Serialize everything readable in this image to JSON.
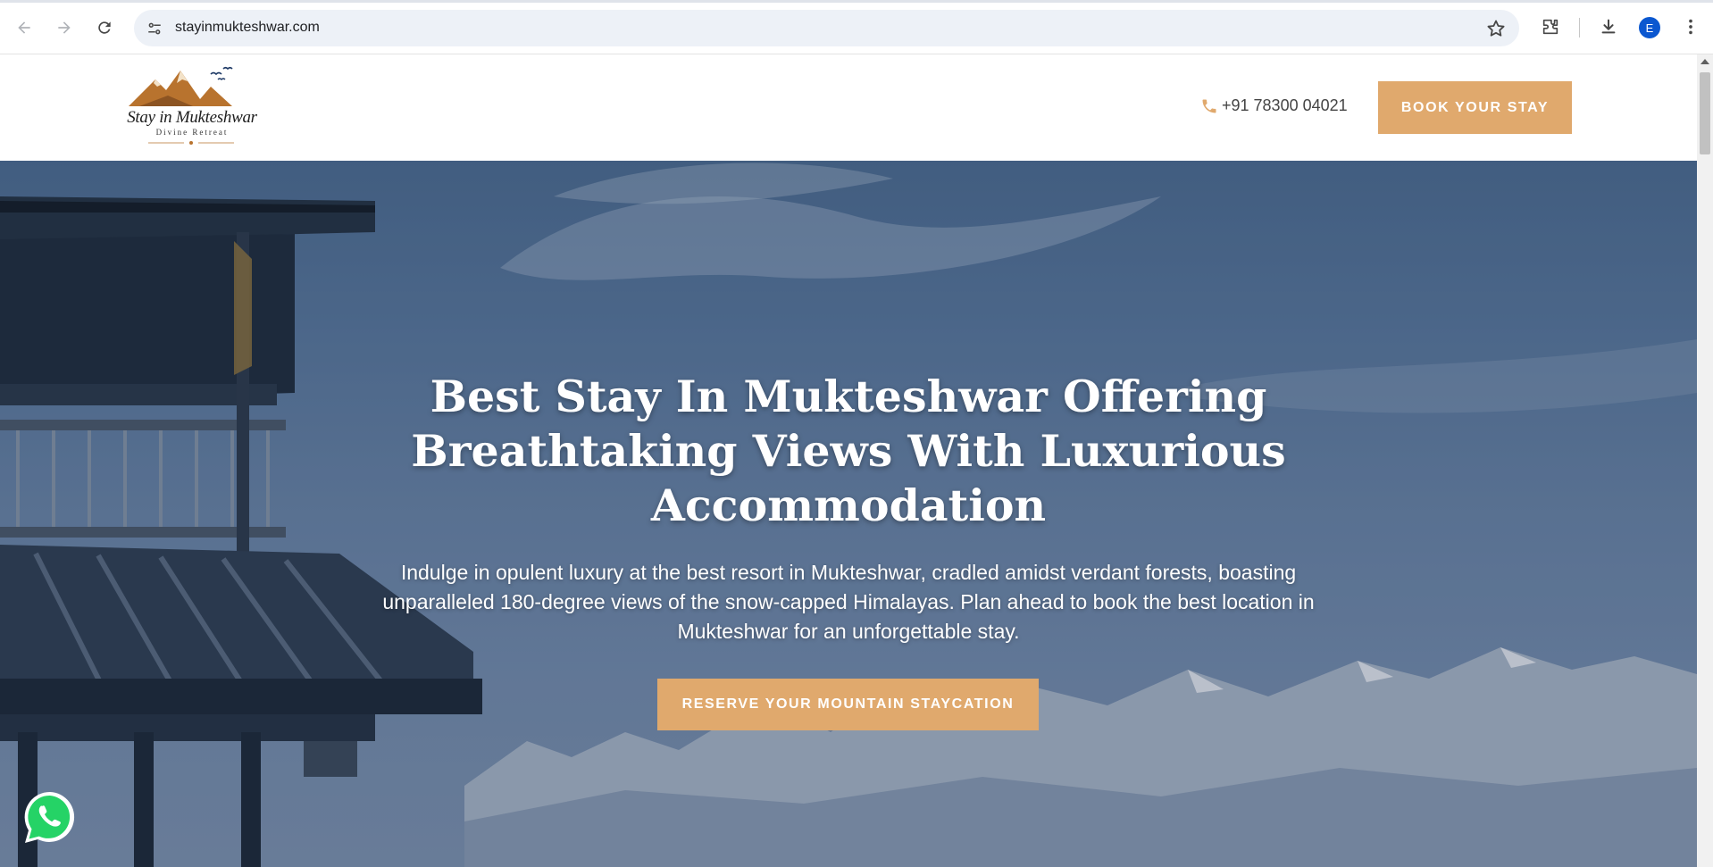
{
  "browser": {
    "url": "stayinmukteshwar.com",
    "profile_initial": "E",
    "icons": [
      "back-arrow-icon",
      "forward-arrow-icon",
      "reload-icon",
      "site-info-icon",
      "bookmark-star-icon",
      "extensions-icon",
      "download-icon",
      "menu-kebab-icon"
    ]
  },
  "header": {
    "logo_name": "Stay in Mukteshwar",
    "logo_tagline": "Divine Retreat",
    "phone": "+91 78300 04021",
    "book_label": "BOOK YOUR STAY"
  },
  "hero": {
    "title": "Best Stay In Mukteshwar Offering Breathtaking Views With Luxurious Accommodation",
    "subtitle": "Indulge in opulent luxury at the best resort in Mukteshwar, cradled amidst verdant forests, boasting unparalleled 180-degree views of the snow-capped Himalayas. Plan ahead to book the best location in Mukteshwar for an unforgettable stay.",
    "cta_label": "RESERVE YOUR MOUNTAIN STAYCATION"
  },
  "colors": {
    "accent": "#e0a96d",
    "sky": "#5b7ba0",
    "whatsapp": "#25d366",
    "profile": "#0b57d0"
  }
}
